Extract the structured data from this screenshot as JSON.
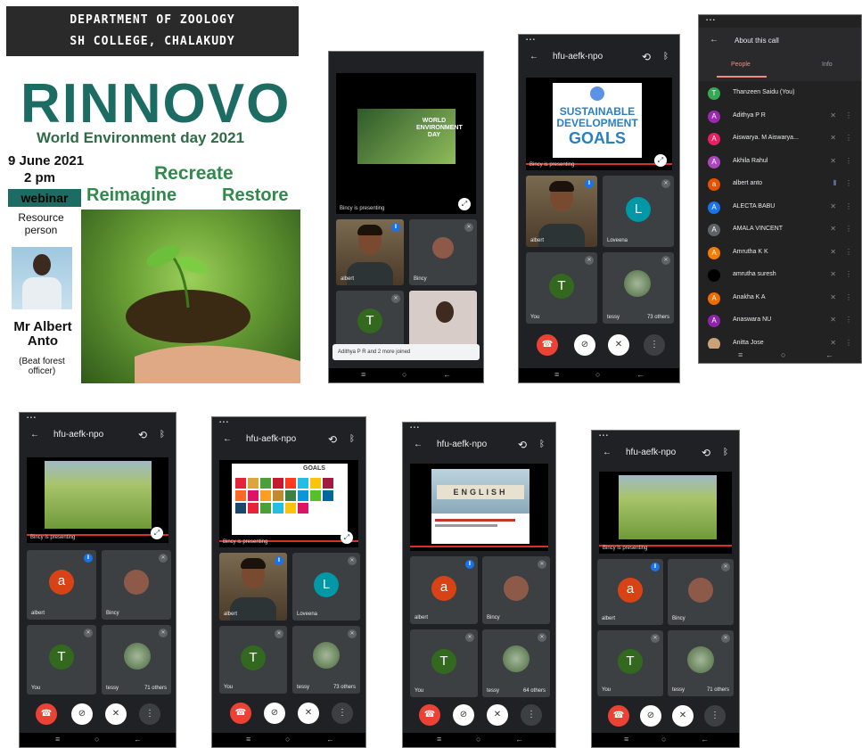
{
  "poster": {
    "dept_line1": "DEPARTMENT OF ZOOLOGY",
    "dept_line2": "SH COLLEGE, CHALAKUDY",
    "title": "RINNOVO",
    "subtitle": "World Environment day 2021",
    "date": "9 June 2021",
    "time": "2 pm",
    "badge": "webinar",
    "tag1": "Recreate",
    "tag2": "Reimagine",
    "tag3": "Restore",
    "resource_label": "Resource person",
    "speaker_name": "Mr Albert Anto",
    "speaker_role": "(Beat forest officer)"
  },
  "meeting": {
    "code": "hfu-aefk-npo",
    "presenting": "Bincy is presenting",
    "slide_wed": "WORLD ENVIRONMENT DAY",
    "slide_sdg_line1": "SUSTAINABLE",
    "slide_sdg_line2": "DEVELOPMENT",
    "slide_sdg_line3": "GOALS",
    "slide_goals": "GOALS",
    "slide_english": "ENGLISH",
    "joined_toast": "Adithya P R and 2 more joined"
  },
  "participants": {
    "albert": "albert",
    "bincy": "Bincy",
    "loveena": "Loveena",
    "you": "You",
    "tessy": "tessy",
    "others_73": "73 others",
    "others_71": "71 others",
    "others_64": "64 others"
  },
  "people_panel": {
    "title": "About this call",
    "tab_people": "People",
    "tab_info": "Info",
    "list": [
      {
        "initial": "T",
        "name": "Thanzeen Saidu (You)",
        "color": "#34a853"
      },
      {
        "initial": "A",
        "name": "Adithya P R",
        "color": "#9c27b0"
      },
      {
        "initial": "A",
        "name": "Aiswarya. M Aiswarya...",
        "color": "#e91e63"
      },
      {
        "initial": "A",
        "name": "Akhila Rahul",
        "color": "#ab47bc"
      },
      {
        "initial": "a",
        "name": "albert anto",
        "color": "#e65100"
      },
      {
        "initial": "A",
        "name": "ALECTA BABU",
        "color": "#1a73e8"
      },
      {
        "initial": "A",
        "name": "AMALA VINCENT",
        "color": "#5f6368"
      },
      {
        "initial": "A",
        "name": "Amrutha K K",
        "color": "#f57c00"
      },
      {
        "initial": "",
        "name": "amrutha suresh",
        "color": "#000000"
      },
      {
        "initial": "A",
        "name": "Anakha K A",
        "color": "#ef6c00"
      },
      {
        "initial": "A",
        "name": "Anaswara NU",
        "color": "#8e24aa"
      },
      {
        "initial": "",
        "name": "Anitta Jose",
        "color": "#c9a27a"
      }
    ]
  },
  "colors": {
    "end_call": "#ea4335",
    "avatar_a": "#d84315",
    "avatar_t": "#33691e",
    "avatar_l": "#0097a7",
    "teal": "#1d6c63"
  }
}
